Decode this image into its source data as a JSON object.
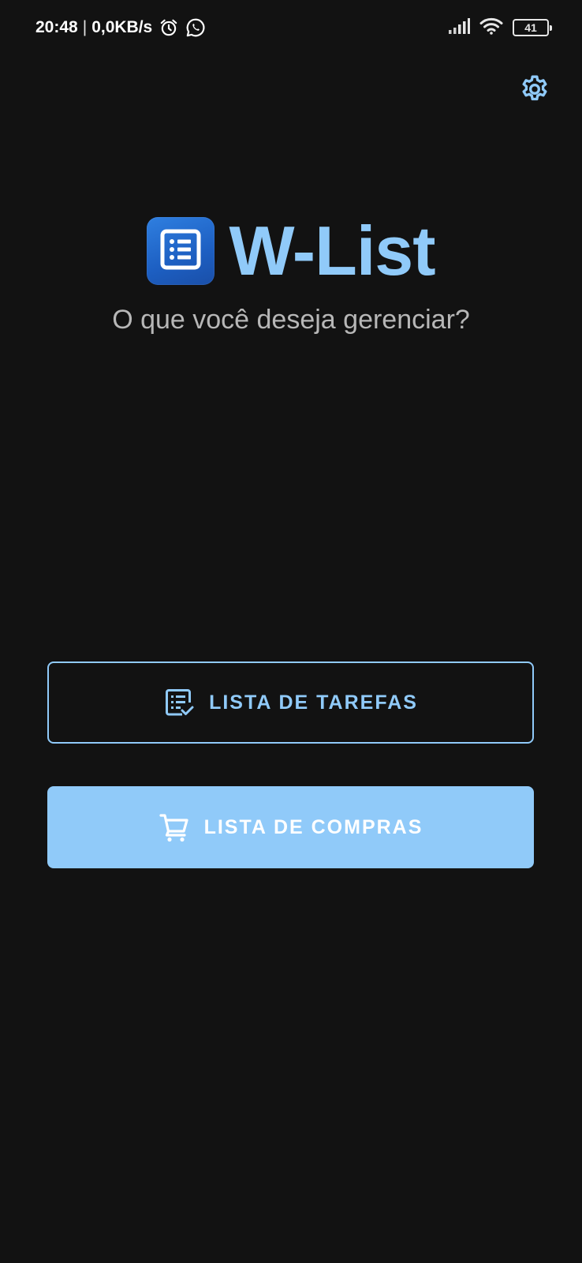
{
  "status_bar": {
    "time": "20:48",
    "separator": "|",
    "network_speed": "0,0KB/s",
    "left_icons": [
      "alarm-icon",
      "whatsapp-icon"
    ],
    "right_icons": [
      "signal-icon",
      "wifi-icon",
      "battery-icon"
    ],
    "battery_level": "41"
  },
  "header": {
    "settings_icon": "gear-icon",
    "app_icon": "list-icon",
    "app_title": "W-List",
    "subtitle": "O que você deseja gerenciar?"
  },
  "actions": {
    "tasks": {
      "label": "LISTA DE TAREFAS",
      "icon": "task-list-icon"
    },
    "shopping": {
      "label": "LISTA DE COMPRAS",
      "icon": "shopping-cart-icon"
    }
  },
  "colors": {
    "background": "#121212",
    "accent": "#90caf9",
    "subtitle": "#b7b7b7",
    "app_icon": "#2f7fe0"
  }
}
